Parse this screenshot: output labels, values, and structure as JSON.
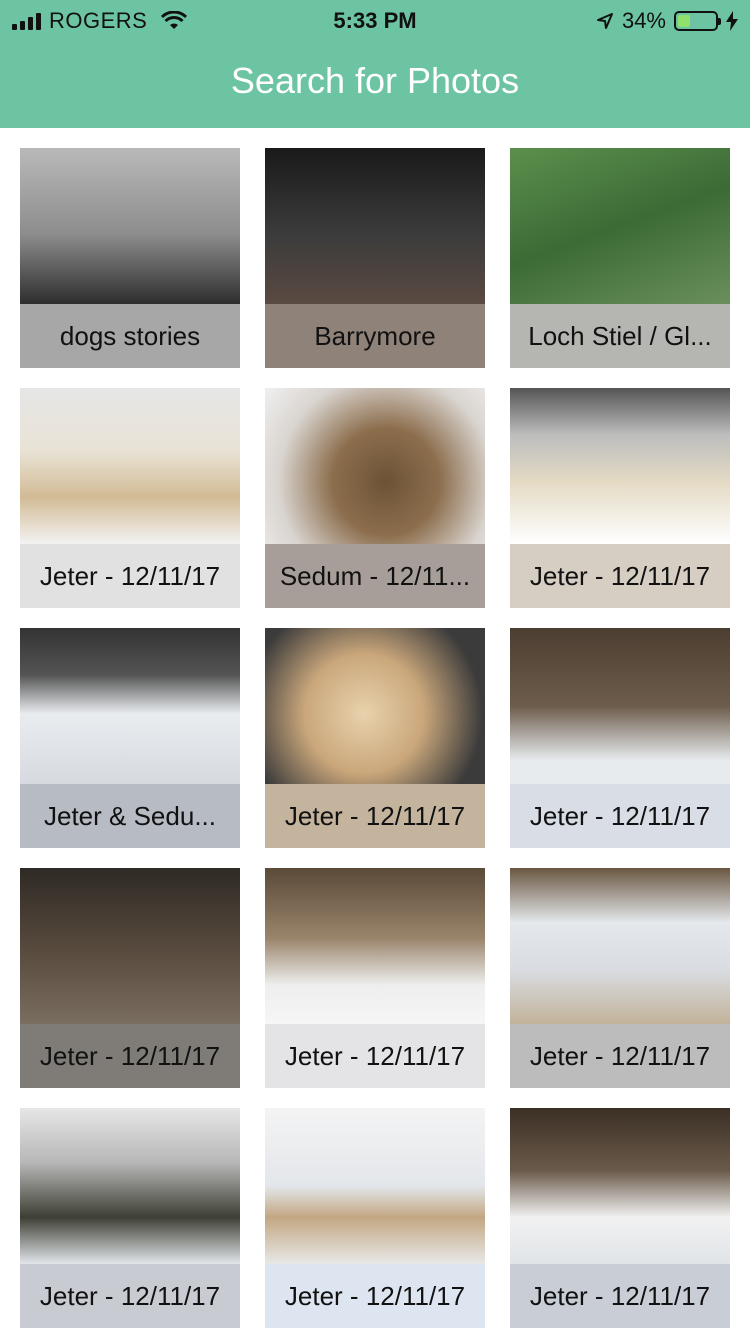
{
  "status_bar": {
    "carrier": "ROGERS",
    "time": "5:33 PM",
    "battery_percent": "34%",
    "battery_level": 0.34
  },
  "header": {
    "title": "Search for Photos",
    "color": "#6cc4a2"
  },
  "photos": [
    {
      "label": "dogs stories",
      "label_bg": "#a7a7a7",
      "photo": "p-bw"
    },
    {
      "label": "Barrymore",
      "label_bg": "#8e8279",
      "photo": "p-marquee"
    },
    {
      "label": "Loch Stiel / Gl...",
      "label_bg": "#b5b6b2",
      "photo": "p-forest"
    },
    {
      "label": "Jeter - 12/11/17",
      "label_bg": "#e1e1e1",
      "photo": "p-snowdog"
    },
    {
      "label": "Sedum - 12/11...",
      "label_bg": "#a89e99",
      "photo": "p-closeup"
    },
    {
      "label": "Jeter - 12/11/17",
      "label_bg": "#d6cdc3",
      "photo": "p-fencedog"
    },
    {
      "label": "Jeter & Sedu...",
      "label_bg": "#b7bbc3",
      "photo": "p-woodsnow"
    },
    {
      "label": "Jeter - 12/11/17",
      "label_bg": "#c4b49e",
      "photo": "p-face"
    },
    {
      "label": "Jeter - 12/11/17",
      "label_bg": "#d8dde6",
      "photo": "p-trees1"
    },
    {
      "label": "Jeter - 12/11/17",
      "label_bg": "#7f7c78",
      "photo": "p-trees2"
    },
    {
      "label": "Jeter - 12/11/17",
      "label_bg": "#e4e4e6",
      "photo": "p-trees3"
    },
    {
      "label": "Jeter - 12/11/17",
      "label_bg": "#bcbcbc",
      "photo": "p-hill"
    },
    {
      "label": "Jeter - 12/11/17",
      "label_bg": "#c8ccd2",
      "photo": "p-sunny"
    },
    {
      "label": "Jeter - 12/11/17",
      "label_bg": "#dde6f0",
      "photo": "p-walk"
    },
    {
      "label": "Jeter - 12/11/17",
      "label_bg": "#c9ced6",
      "photo": "p-woods4"
    }
  ]
}
